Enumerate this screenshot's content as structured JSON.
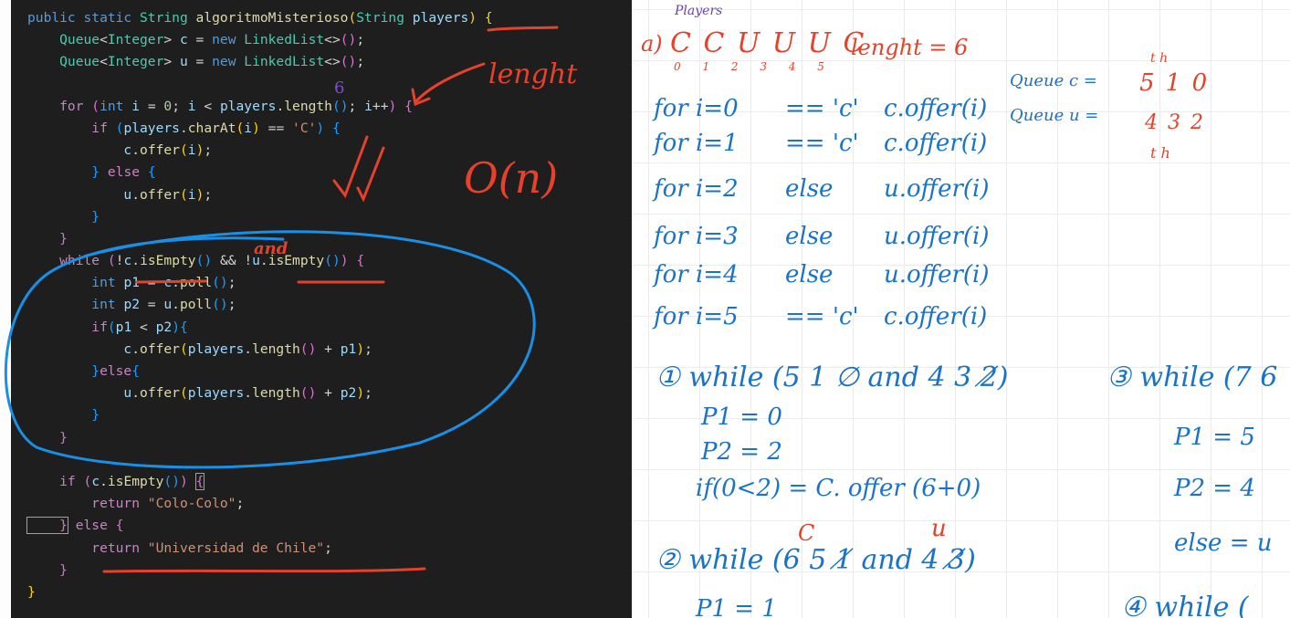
{
  "editor": {
    "code_lines": [
      [
        {
          "t": "public static ",
          "c": "kw"
        },
        {
          "t": "String ",
          "c": "ty"
        },
        {
          "t": "algoritmoMisterioso",
          "c": "fn"
        },
        {
          "t": "(",
          "c": "br1"
        },
        {
          "t": "String ",
          "c": "ty"
        },
        {
          "t": "players",
          "c": "var"
        },
        {
          "t": ") ",
          "c": "br1"
        },
        {
          "t": "{",
          "c": "br1"
        }
      ],
      [
        {
          "t": "    Queue",
          "c": "ty"
        },
        {
          "t": "<",
          "c": "pun"
        },
        {
          "t": "Integer",
          "c": "ty"
        },
        {
          "t": "> ",
          "c": "pun"
        },
        {
          "t": "c",
          "c": "var"
        },
        {
          "t": " = ",
          "c": "pun"
        },
        {
          "t": "new ",
          "c": "kw"
        },
        {
          "t": "LinkedList",
          "c": "ty"
        },
        {
          "t": "<>",
          "c": "pun"
        },
        {
          "t": "()",
          "c": "br2"
        },
        {
          "t": ";",
          "c": "pun"
        }
      ],
      [
        {
          "t": "    Queue",
          "c": "ty"
        },
        {
          "t": "<",
          "c": "pun"
        },
        {
          "t": "Integer",
          "c": "ty"
        },
        {
          "t": "> ",
          "c": "pun"
        },
        {
          "t": "u",
          "c": "var"
        },
        {
          "t": " = ",
          "c": "pun"
        },
        {
          "t": "new ",
          "c": "kw"
        },
        {
          "t": "LinkedList",
          "c": "ty"
        },
        {
          "t": "<>",
          "c": "pun"
        },
        {
          "t": "()",
          "c": "br2"
        },
        {
          "t": ";",
          "c": "pun"
        }
      ],
      [],
      [
        {
          "t": "    for ",
          "c": "kc"
        },
        {
          "t": "(",
          "c": "br2"
        },
        {
          "t": "int ",
          "c": "kw"
        },
        {
          "t": "i",
          "c": "var"
        },
        {
          "t": " = ",
          "c": "pun"
        },
        {
          "t": "0",
          "c": "num"
        },
        {
          "t": "; ",
          "c": "pun"
        },
        {
          "t": "i",
          "c": "var"
        },
        {
          "t": " < ",
          "c": "pun"
        },
        {
          "t": "players",
          "c": "var"
        },
        {
          "t": ".",
          "c": "pun"
        },
        {
          "t": "length",
          "c": "fn"
        },
        {
          "t": "()",
          "c": "br3"
        },
        {
          "t": "; ",
          "c": "pun"
        },
        {
          "t": "i",
          "c": "var"
        },
        {
          "t": "++",
          "c": "pun"
        },
        {
          "t": ") ",
          "c": "br2"
        },
        {
          "t": "{",
          "c": "br2"
        }
      ],
      [
        {
          "t": "        if ",
          "c": "kc"
        },
        {
          "t": "(",
          "c": "br3"
        },
        {
          "t": "players",
          "c": "var"
        },
        {
          "t": ".",
          "c": "pun"
        },
        {
          "t": "charAt",
          "c": "fn"
        },
        {
          "t": "(",
          "c": "br1"
        },
        {
          "t": "i",
          "c": "var"
        },
        {
          "t": ")",
          "c": "br1"
        },
        {
          "t": " == ",
          "c": "pun"
        },
        {
          "t": "'C'",
          "c": "str"
        },
        {
          "t": ") ",
          "c": "br3"
        },
        {
          "t": "{",
          "c": "br3"
        }
      ],
      [
        {
          "t": "            c",
          "c": "var"
        },
        {
          "t": ".",
          "c": "pun"
        },
        {
          "t": "offer",
          "c": "fn"
        },
        {
          "t": "(",
          "c": "br1"
        },
        {
          "t": "i",
          "c": "var"
        },
        {
          "t": ")",
          "c": "br1"
        },
        {
          "t": ";",
          "c": "pun"
        }
      ],
      [
        {
          "t": "        } ",
          "c": "br3"
        },
        {
          "t": "else ",
          "c": "kc"
        },
        {
          "t": "{",
          "c": "br3"
        }
      ],
      [
        {
          "t": "            u",
          "c": "var"
        },
        {
          "t": ".",
          "c": "pun"
        },
        {
          "t": "offer",
          "c": "fn"
        },
        {
          "t": "(",
          "c": "br1"
        },
        {
          "t": "i",
          "c": "var"
        },
        {
          "t": ")",
          "c": "br1"
        },
        {
          "t": ";",
          "c": "pun"
        }
      ],
      [
        {
          "t": "        }",
          "c": "br3"
        }
      ],
      [
        {
          "t": "    }",
          "c": "br2"
        }
      ],
      [
        {
          "t": "    while ",
          "c": "kc"
        },
        {
          "t": "(",
          "c": "br2"
        },
        {
          "t": "!",
          "c": "pun"
        },
        {
          "t": "c",
          "c": "var"
        },
        {
          "t": ".",
          "c": "pun"
        },
        {
          "t": "isEmpty",
          "c": "fn"
        },
        {
          "t": "()",
          "c": "br3"
        },
        {
          "t": " && ",
          "c": "pun"
        },
        {
          "t": "!",
          "c": "pun"
        },
        {
          "t": "u",
          "c": "var"
        },
        {
          "t": ".",
          "c": "pun"
        },
        {
          "t": "isEmpty",
          "c": "fn"
        },
        {
          "t": "()",
          "c": "br3"
        },
        {
          "t": ") ",
          "c": "br2"
        },
        {
          "t": "{",
          "c": "br2"
        }
      ],
      [
        {
          "t": "        int ",
          "c": "kw"
        },
        {
          "t": "p1",
          "c": "var"
        },
        {
          "t": " = ",
          "c": "pun"
        },
        {
          "t": "c",
          "c": "var"
        },
        {
          "t": ".",
          "c": "pun"
        },
        {
          "t": "poll",
          "c": "fn"
        },
        {
          "t": "()",
          "c": "br3"
        },
        {
          "t": ";",
          "c": "pun"
        }
      ],
      [
        {
          "t": "        int ",
          "c": "kw"
        },
        {
          "t": "p2",
          "c": "var"
        },
        {
          "t": " = ",
          "c": "pun"
        },
        {
          "t": "u",
          "c": "var"
        },
        {
          "t": ".",
          "c": "pun"
        },
        {
          "t": "poll",
          "c": "fn"
        },
        {
          "t": "()",
          "c": "br3"
        },
        {
          "t": ";",
          "c": "pun"
        }
      ],
      [
        {
          "t": "        if",
          "c": "kc"
        },
        {
          "t": "(",
          "c": "br3"
        },
        {
          "t": "p1",
          "c": "var"
        },
        {
          "t": " < ",
          "c": "pun"
        },
        {
          "t": "p2",
          "c": "var"
        },
        {
          "t": ")",
          "c": "br3"
        },
        {
          "t": "{",
          "c": "br3"
        }
      ],
      [
        {
          "t": "            c",
          "c": "var"
        },
        {
          "t": ".",
          "c": "pun"
        },
        {
          "t": "offer",
          "c": "fn"
        },
        {
          "t": "(",
          "c": "br1"
        },
        {
          "t": "players",
          "c": "var"
        },
        {
          "t": ".",
          "c": "pun"
        },
        {
          "t": "length",
          "c": "fn"
        },
        {
          "t": "()",
          "c": "br2"
        },
        {
          "t": " + ",
          "c": "pun"
        },
        {
          "t": "p1",
          "c": "var"
        },
        {
          "t": ")",
          "c": "br1"
        },
        {
          "t": ";",
          "c": "pun"
        }
      ],
      [
        {
          "t": "        }",
          "c": "br3"
        },
        {
          "t": "else",
          "c": "kc"
        },
        {
          "t": "{",
          "c": "br3"
        }
      ],
      [
        {
          "t": "            u",
          "c": "var"
        },
        {
          "t": ".",
          "c": "pun"
        },
        {
          "t": "offer",
          "c": "fn"
        },
        {
          "t": "(",
          "c": "br1"
        },
        {
          "t": "players",
          "c": "var"
        },
        {
          "t": ".",
          "c": "pun"
        },
        {
          "t": "length",
          "c": "fn"
        },
        {
          "t": "()",
          "c": "br2"
        },
        {
          "t": " + ",
          "c": "pun"
        },
        {
          "t": "p2",
          "c": "var"
        },
        {
          "t": ")",
          "c": "br1"
        },
        {
          "t": ";",
          "c": "pun"
        }
      ],
      [
        {
          "t": "        }",
          "c": "br3"
        }
      ],
      [
        {
          "t": "    }",
          "c": "br2"
        }
      ],
      [],
      [
        {
          "t": "    if ",
          "c": "kc"
        },
        {
          "t": "(",
          "c": "br2"
        },
        {
          "t": "c",
          "c": "var"
        },
        {
          "t": ".",
          "c": "pun"
        },
        {
          "t": "isEmpty",
          "c": "fn"
        },
        {
          "t": "()",
          "c": "br3"
        },
        {
          "t": ") ",
          "c": "br2"
        },
        {
          "t": "{",
          "c": "br2 cursorbox"
        }
      ],
      [
        {
          "t": "        return ",
          "c": "kc"
        },
        {
          "t": "\"Colo-Colo\"",
          "c": "str"
        },
        {
          "t": ";",
          "c": "pun"
        }
      ],
      [
        {
          "t": "    }",
          "c": "br2 cursorbox"
        },
        {
          "t": " else ",
          "c": "kc"
        },
        {
          "t": "{",
          "c": "br2"
        }
      ],
      [
        {
          "t": "        return ",
          "c": "kc"
        },
        {
          "t": "\"Universidad de Chile\"",
          "c": "str"
        },
        {
          "t": ";",
          "c": "pun"
        }
      ],
      [
        {
          "t": "    }",
          "c": "br2"
        }
      ],
      [
        {
          "t": "}",
          "c": "br1"
        }
      ]
    ],
    "annotations": {
      "lenght": "lenght",
      "six": "6",
      "complexity": "O(n)",
      "and": "and"
    },
    "ink_colors": {
      "red": "#e6412a",
      "blue": "#1a8fe6",
      "purple": "#7a4fd6"
    }
  },
  "notes": {
    "players_label": "Players",
    "part_a": "a)",
    "sequence": "C C U U U C",
    "indices": "0 1 2 3 4 5",
    "lenght_eq": "lenght = 6",
    "head_tail_top": "t    h",
    "queue_c_label": "Queue c =",
    "queue_c_vals": "5 1 0",
    "queue_u_label": "Queue u =",
    "queue_u_vals": "4 3 2",
    "head_tail_bottom": "t    h",
    "loop_rows": [
      {
        "a": "for  i=0",
        "b": "==  'c'",
        "c": "c.offer(i)"
      },
      {
        "a": "for  i=1",
        "b": "==  'c'",
        "c": "c.offer(i)"
      },
      {
        "a": "for  i=2",
        "b": "else",
        "c": "u.offer(i)"
      },
      {
        "a": "for  i=3",
        "b": "else",
        "c": "u.offer(i)"
      },
      {
        "a": "for  i=4",
        "b": "else",
        "c": "u.offer(i)"
      },
      {
        "a": "for  i=5",
        "b": "==  'c'",
        "c": "c.offer(i)"
      }
    ],
    "w1": "① while (5 1 ∅  and  4 3 2̸)",
    "w1_p1": "P1 = 0",
    "w1_p2": "P2 = 2",
    "w1_if": "if(0<2) = C. offer (6+0)",
    "w2_c": "C",
    "w2_u": "u",
    "w2": "② while (6 5 1̸  and  4 3̸)",
    "w2_p1": "P1 = 1",
    "w3": "③ while (7 6",
    "w3_p1": "P1 = 5",
    "w3_p2": "P2 = 4",
    "w3_else": "else = u",
    "w4": "④ while (",
    "ink_colors": {
      "orange": "#e6412a",
      "blue": "#1a73c9",
      "purple": "#6b3fb5"
    }
  }
}
